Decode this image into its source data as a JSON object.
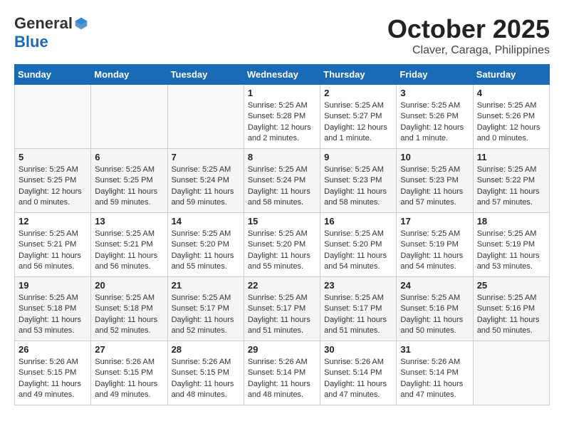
{
  "header": {
    "logo_general": "General",
    "logo_blue": "Blue",
    "month_title": "October 2025",
    "location": "Claver, Caraga, Philippines"
  },
  "days_of_week": [
    "Sunday",
    "Monday",
    "Tuesday",
    "Wednesday",
    "Thursday",
    "Friday",
    "Saturday"
  ],
  "weeks": [
    [
      {
        "day": "",
        "info": ""
      },
      {
        "day": "",
        "info": ""
      },
      {
        "day": "",
        "info": ""
      },
      {
        "day": "1",
        "info": "Sunrise: 5:25 AM\nSunset: 5:28 PM\nDaylight: 12 hours and 2 minutes."
      },
      {
        "day": "2",
        "info": "Sunrise: 5:25 AM\nSunset: 5:27 PM\nDaylight: 12 hours and 1 minute."
      },
      {
        "day": "3",
        "info": "Sunrise: 5:25 AM\nSunset: 5:26 PM\nDaylight: 12 hours and 1 minute."
      },
      {
        "day": "4",
        "info": "Sunrise: 5:25 AM\nSunset: 5:26 PM\nDaylight: 12 hours and 0 minutes."
      }
    ],
    [
      {
        "day": "5",
        "info": "Sunrise: 5:25 AM\nSunset: 5:25 PM\nDaylight: 12 hours and 0 minutes."
      },
      {
        "day": "6",
        "info": "Sunrise: 5:25 AM\nSunset: 5:25 PM\nDaylight: 11 hours and 59 minutes."
      },
      {
        "day": "7",
        "info": "Sunrise: 5:25 AM\nSunset: 5:24 PM\nDaylight: 11 hours and 59 minutes."
      },
      {
        "day": "8",
        "info": "Sunrise: 5:25 AM\nSunset: 5:24 PM\nDaylight: 11 hours and 58 minutes."
      },
      {
        "day": "9",
        "info": "Sunrise: 5:25 AM\nSunset: 5:23 PM\nDaylight: 11 hours and 58 minutes."
      },
      {
        "day": "10",
        "info": "Sunrise: 5:25 AM\nSunset: 5:23 PM\nDaylight: 11 hours and 57 minutes."
      },
      {
        "day": "11",
        "info": "Sunrise: 5:25 AM\nSunset: 5:22 PM\nDaylight: 11 hours and 57 minutes."
      }
    ],
    [
      {
        "day": "12",
        "info": "Sunrise: 5:25 AM\nSunset: 5:21 PM\nDaylight: 11 hours and 56 minutes."
      },
      {
        "day": "13",
        "info": "Sunrise: 5:25 AM\nSunset: 5:21 PM\nDaylight: 11 hours and 56 minutes."
      },
      {
        "day": "14",
        "info": "Sunrise: 5:25 AM\nSunset: 5:20 PM\nDaylight: 11 hours and 55 minutes."
      },
      {
        "day": "15",
        "info": "Sunrise: 5:25 AM\nSunset: 5:20 PM\nDaylight: 11 hours and 55 minutes."
      },
      {
        "day": "16",
        "info": "Sunrise: 5:25 AM\nSunset: 5:20 PM\nDaylight: 11 hours and 54 minutes."
      },
      {
        "day": "17",
        "info": "Sunrise: 5:25 AM\nSunset: 5:19 PM\nDaylight: 11 hours and 54 minutes."
      },
      {
        "day": "18",
        "info": "Sunrise: 5:25 AM\nSunset: 5:19 PM\nDaylight: 11 hours and 53 minutes."
      }
    ],
    [
      {
        "day": "19",
        "info": "Sunrise: 5:25 AM\nSunset: 5:18 PM\nDaylight: 11 hours and 53 minutes."
      },
      {
        "day": "20",
        "info": "Sunrise: 5:25 AM\nSunset: 5:18 PM\nDaylight: 11 hours and 52 minutes."
      },
      {
        "day": "21",
        "info": "Sunrise: 5:25 AM\nSunset: 5:17 PM\nDaylight: 11 hours and 52 minutes."
      },
      {
        "day": "22",
        "info": "Sunrise: 5:25 AM\nSunset: 5:17 PM\nDaylight: 11 hours and 51 minutes."
      },
      {
        "day": "23",
        "info": "Sunrise: 5:25 AM\nSunset: 5:17 PM\nDaylight: 11 hours and 51 minutes."
      },
      {
        "day": "24",
        "info": "Sunrise: 5:25 AM\nSunset: 5:16 PM\nDaylight: 11 hours and 50 minutes."
      },
      {
        "day": "25",
        "info": "Sunrise: 5:25 AM\nSunset: 5:16 PM\nDaylight: 11 hours and 50 minutes."
      }
    ],
    [
      {
        "day": "26",
        "info": "Sunrise: 5:26 AM\nSunset: 5:15 PM\nDaylight: 11 hours and 49 minutes."
      },
      {
        "day": "27",
        "info": "Sunrise: 5:26 AM\nSunset: 5:15 PM\nDaylight: 11 hours and 49 minutes."
      },
      {
        "day": "28",
        "info": "Sunrise: 5:26 AM\nSunset: 5:15 PM\nDaylight: 11 hours and 48 minutes."
      },
      {
        "day": "29",
        "info": "Sunrise: 5:26 AM\nSunset: 5:14 PM\nDaylight: 11 hours and 48 minutes."
      },
      {
        "day": "30",
        "info": "Sunrise: 5:26 AM\nSunset: 5:14 PM\nDaylight: 11 hours and 47 minutes."
      },
      {
        "day": "31",
        "info": "Sunrise: 5:26 AM\nSunset: 5:14 PM\nDaylight: 11 hours and 47 minutes."
      },
      {
        "day": "",
        "info": ""
      }
    ]
  ]
}
